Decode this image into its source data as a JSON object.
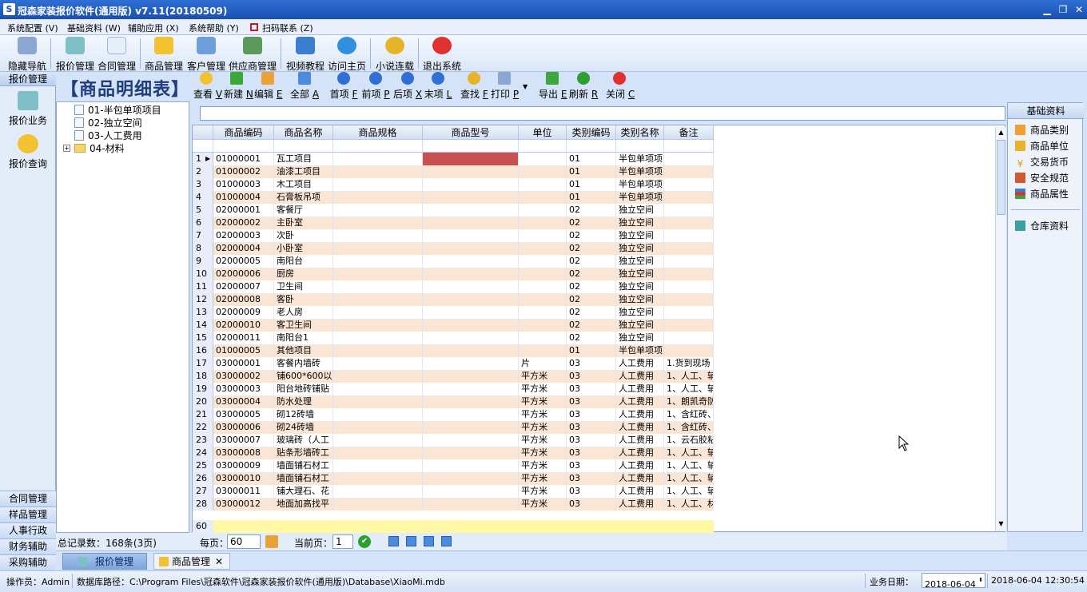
{
  "window": {
    "title": "冠森家装报价软件(通用版) v7.11(20180509)",
    "icon_text": "S"
  },
  "menu": [
    "系统配置 (V)",
    "基础资料 (W)",
    "辅助应用 (X)",
    "系统帮助 (Y)",
    "扫码联系 (Z)"
  ],
  "toolbar": [
    {
      "label": "隐藏导航",
      "icon": "navigation-icon"
    },
    {
      "label": "报价管理",
      "icon": "calculator-icon"
    },
    {
      "label": "合同管理",
      "icon": "document-icon"
    },
    {
      "label": "商品管理",
      "icon": "box-icon"
    },
    {
      "label": "客户管理",
      "icon": "customers-icon"
    },
    {
      "label": "供应商管理",
      "icon": "supplier-icon"
    },
    {
      "label": "视频教程",
      "icon": "film-icon"
    },
    {
      "label": "访问主页",
      "icon": "globe-icon"
    },
    {
      "label": "小说连载",
      "icon": "flower-icon"
    },
    {
      "label": "退出系统",
      "icon": "stop-icon"
    }
  ],
  "leftnav": {
    "header": "报价管理",
    "items": [
      {
        "label": "报价业务",
        "icon": "calculator-icon"
      },
      {
        "label": "报价查询",
        "icon": "magnifier-icon"
      }
    ],
    "bottom": [
      "合同管理",
      "样品管理",
      "人事行政",
      "财务辅助",
      "采购辅助"
    ]
  },
  "tree": [
    {
      "label": "01-半包单项项目"
    },
    {
      "label": "02-独立空间"
    },
    {
      "label": "03-人工费用"
    },
    {
      "label": "04-材料",
      "expander": "+"
    }
  ],
  "page_title": "【商品明细表】",
  "grid_tools": [
    {
      "label": "查看",
      "key": "V",
      "icon": "view-icon"
    },
    {
      "label": "新建",
      "key": "N",
      "icon": "new-icon"
    },
    {
      "label": "编辑",
      "key": "E",
      "icon": "edit-icon"
    },
    {
      "label": "全部",
      "key": "A",
      "icon": "all-icon"
    },
    {
      "label": "首项",
      "key": "F",
      "icon": "first-icon"
    },
    {
      "label": "前项",
      "key": "P",
      "icon": "prev-icon"
    },
    {
      "label": "后项",
      "key": "X",
      "icon": "next-icon"
    },
    {
      "label": "末项",
      "key": "L",
      "icon": "last-icon"
    },
    {
      "label": "查找",
      "key": "F",
      "icon": "find-icon"
    },
    {
      "label": "打印",
      "key": "P",
      "icon": "print-icon"
    },
    {
      "label": "导出",
      "key": "E",
      "icon": "export-icon"
    },
    {
      "label": "刷新",
      "key": "R",
      "icon": "refresh-icon"
    },
    {
      "label": "关闭",
      "key": "C",
      "icon": "close-icon"
    }
  ],
  "grid": {
    "columns": [
      "商品编码",
      "商品名称",
      "商品规格",
      "商品型号",
      "单位",
      "类别编码",
      "类别名称",
      "备注"
    ],
    "rows": [
      [
        "1",
        "01000001",
        "瓦工项目",
        "",
        "",
        "",
        "01",
        "半包单项项",
        ""
      ],
      [
        "2",
        "01000002",
        "油漆工项目",
        "",
        "",
        "",
        "01",
        "半包单项项",
        ""
      ],
      [
        "3",
        "01000003",
        "木工项目",
        "",
        "",
        "",
        "01",
        "半包单项项",
        ""
      ],
      [
        "4",
        "01000004",
        "石膏板吊项",
        "",
        "",
        "",
        "01",
        "半包单项项",
        ""
      ],
      [
        "5",
        "02000001",
        "客餐厅",
        "",
        "",
        "",
        "02",
        "独立空间",
        ""
      ],
      [
        "6",
        "02000002",
        "主卧室",
        "",
        "",
        "",
        "02",
        "独立空间",
        ""
      ],
      [
        "7",
        "02000003",
        "次卧",
        "",
        "",
        "",
        "02",
        "独立空间",
        ""
      ],
      [
        "8",
        "02000004",
        "小卧室",
        "",
        "",
        "",
        "02",
        "独立空间",
        ""
      ],
      [
        "9",
        "02000005",
        "南阳台",
        "",
        "",
        "",
        "02",
        "独立空间",
        ""
      ],
      [
        "10",
        "02000006",
        "厨房",
        "",
        "",
        "",
        "02",
        "独立空间",
        ""
      ],
      [
        "11",
        "02000007",
        "卫生间",
        "",
        "",
        "",
        "02",
        "独立空间",
        ""
      ],
      [
        "12",
        "02000008",
        "客卧",
        "",
        "",
        "",
        "02",
        "独立空间",
        ""
      ],
      [
        "13",
        "02000009",
        "老人房",
        "",
        "",
        "",
        "02",
        "独立空间",
        ""
      ],
      [
        "14",
        "02000010",
        "客卫生间",
        "",
        "",
        "",
        "02",
        "独立空间",
        ""
      ],
      [
        "15",
        "02000011",
        "南阳台1",
        "",
        "",
        "",
        "02",
        "独立空间",
        ""
      ],
      [
        "16",
        "01000005",
        "其他项目",
        "",
        "",
        "",
        "01",
        "半包单项项",
        ""
      ],
      [
        "17",
        "03000001",
        "客餐内墙砖",
        "",
        "",
        "片",
        "03",
        "人工费用",
        "1.货到现场"
      ],
      [
        "18",
        "03000002",
        "铺600*600以上",
        "",
        "",
        "平方米",
        "03",
        "人工费用",
        "1、人工、辅"
      ],
      [
        "19",
        "03000003",
        "阳台地砖铺贴",
        "",
        "",
        "平方米",
        "03",
        "人工费用",
        "1、人工、辅"
      ],
      [
        "20",
        "03000004",
        "防水处理",
        "",
        "",
        "平方米",
        "03",
        "人工费用",
        "1、朗凯奇防"
      ],
      [
        "21",
        "03000005",
        "砌12砖墙",
        "",
        "",
        "平方米",
        "03",
        "人工费用",
        "1、含红砖、"
      ],
      [
        "22",
        "03000006",
        "砌24砖墙",
        "",
        "",
        "平方米",
        "03",
        "人工费用",
        "1、含红砖、"
      ],
      [
        "23",
        "03000007",
        "玻璃砖（人工",
        "",
        "",
        "平方米",
        "03",
        "人工费用",
        "1、云石胶粘"
      ],
      [
        "24",
        "03000008",
        "贴条形墙砖工",
        "",
        "",
        "平方米",
        "03",
        "人工费用",
        "1、人工、辅"
      ],
      [
        "25",
        "03000009",
        "墙面铺石材工",
        "",
        "",
        "平方米",
        "03",
        "人工费用",
        "1、人工、辅"
      ],
      [
        "26",
        "03000010",
        "墙面铺石材工",
        "",
        "",
        "平方米",
        "03",
        "人工费用",
        "1、人工、辅"
      ],
      [
        "27",
        "03000011",
        "铺大理石、花",
        "",
        "",
        "平方米",
        "03",
        "人工费用",
        "1、人工、辅"
      ],
      [
        "28",
        "03000012",
        "地面加高找平",
        "",
        "",
        "平方米",
        "03",
        "人工费用",
        "1、人工、材"
      ]
    ],
    "footer_row_number": "60",
    "highlight_color": "#c85050",
    "alt_row_color": "#fbe6d6"
  },
  "rightpanel": {
    "header": "基础资料",
    "items": [
      {
        "label": "商品类别",
        "icon": "category-icon"
      },
      {
        "label": "商品单位",
        "icon": "pencil-icon"
      },
      {
        "label": "交易货币",
        "icon": "yen-icon"
      },
      {
        "label": "安全规范",
        "icon": "shield-icon"
      },
      {
        "label": "商品属性",
        "icon": "list-icon"
      },
      {
        "label": "仓库资料",
        "icon": "warehouse-icon"
      }
    ]
  },
  "pager": {
    "total": "总记录数：168条(3页)",
    "per_page_label": "每页：",
    "per_page": "60",
    "current_label": "当前页：",
    "current": "1"
  },
  "tabs": [
    {
      "label": "报价管理"
    },
    {
      "label": "商品管理",
      "close": "✕"
    }
  ],
  "status": {
    "operator": "操作员：Admin",
    "db_path": "数据库路径：C:\\Program Files\\冠森软件\\冠森家装报价软件(通用版)\\Database\\XiaoMi.mdb",
    "biz_date_label": "业务日期：",
    "biz_date": "2018-06-04",
    "datetime": "2018-06-04 12:30:54"
  }
}
